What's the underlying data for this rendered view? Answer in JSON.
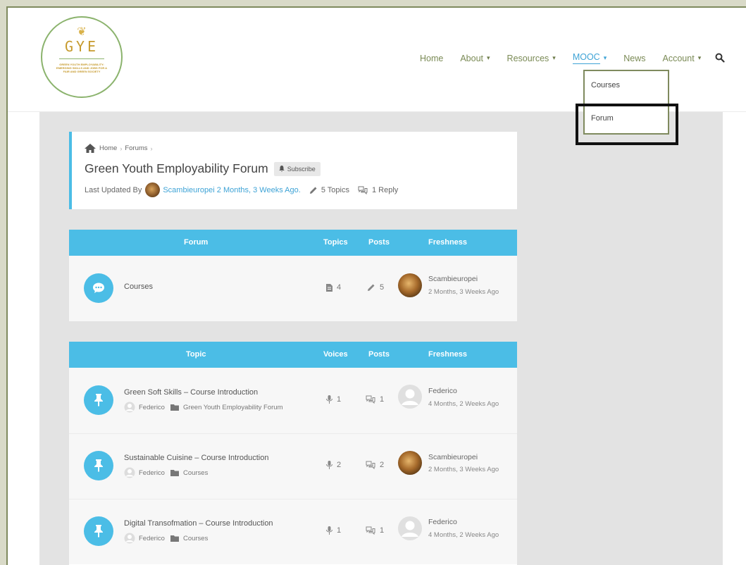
{
  "brand": {
    "logo_title": "GYE",
    "logo_tagline": "GREEN YOUTH EMPLOYABILITY: EMERGING SKILLS AND JOBS FOR A FAIR AND GREEN SOCIETY",
    "accent_color": "#4bbde6",
    "nav_color": "#7a8a55"
  },
  "nav": {
    "items": [
      {
        "label": "Home",
        "has_dropdown": false
      },
      {
        "label": "About",
        "has_dropdown": true
      },
      {
        "label": "Resources",
        "has_dropdown": true
      },
      {
        "label": "MOOC",
        "has_dropdown": true
      },
      {
        "label": "News",
        "has_dropdown": false
      },
      {
        "label": "Account",
        "has_dropdown": true
      }
    ],
    "active": "MOOC",
    "search_icon": "search-icon"
  },
  "dropdown": {
    "items": [
      "Courses",
      "Forum"
    ],
    "highlighted": "Forum"
  },
  "forum_header": {
    "breadcrumb": [
      "Home",
      "Forums"
    ],
    "title": "Green Youth Employability Forum",
    "subscribe_label": "Subscribe",
    "last_updated_prefix": "Last Updated By",
    "last_updated_by": "Scambieuropei 2 Months, 3 Weeks Ago.",
    "topics_count": "5 Topics",
    "replies_count": "1 Reply"
  },
  "forums_table": {
    "columns": [
      "Forum",
      "Topics",
      "Posts",
      "Freshness"
    ],
    "rows": [
      {
        "name": "Courses",
        "topics": "4",
        "posts": "5",
        "fresh_user": "Scambieuropei",
        "fresh_time": "2 Months, 3 Weeks Ago"
      }
    ]
  },
  "topics_table": {
    "columns": [
      "Topic",
      "Voices",
      "Posts",
      "Freshness"
    ],
    "rows": [
      {
        "title": "Green Soft Skills – Course Introduction",
        "author": "Federico",
        "forum": "Green Youth Employability Forum",
        "voices": "1",
        "posts": "1",
        "fresh_user": "Federico",
        "fresh_time": "4 Months, 2 Weeks Ago",
        "avatar": "user"
      },
      {
        "title": "Sustainable Cuisine – Course Introduction",
        "author": "Federico",
        "forum": "Courses",
        "voices": "2",
        "posts": "2",
        "fresh_user": "Scambieuropei",
        "fresh_time": "2 Months, 3 Weeks Ago",
        "avatar": "lion"
      },
      {
        "title": "Digital Transofmation – Course Introduction",
        "author": "Federico",
        "forum": "Courses",
        "voices": "1",
        "posts": "1",
        "fresh_user": "Federico",
        "fresh_time": "4 Months, 2 Weeks Ago",
        "avatar": "user"
      }
    ]
  }
}
